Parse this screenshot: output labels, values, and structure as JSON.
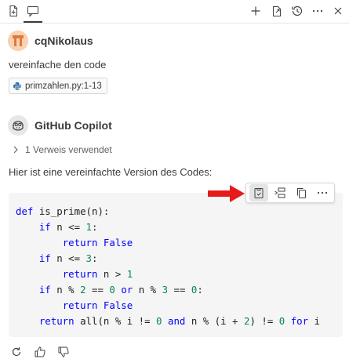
{
  "header": {
    "tabs": [
      {
        "icon": "new-file-icon"
      },
      {
        "icon": "chat-icon",
        "active": true
      }
    ],
    "actions": [
      {
        "icon": "plus-icon"
      },
      {
        "icon": "open-in-editor-icon"
      },
      {
        "icon": "history-icon"
      },
      {
        "icon": "more-icon"
      }
    ]
  },
  "user_message": {
    "username": "cqNikolaus",
    "text": "vereinfache den code",
    "reference_chip": "primzahlen.py:1-13"
  },
  "copilot": {
    "name": "GitHub Copilot",
    "references": "1 Verweis verwendet",
    "intro": "Hier ist eine vereinfachte Version des Codes:",
    "code_lines": [
      [
        {
          "t": "kw",
          "v": "def"
        },
        {
          "t": "plain",
          "v": " is_prime(n):"
        }
      ],
      [
        {
          "t": "plain",
          "v": "    "
        },
        {
          "t": "kw",
          "v": "if"
        },
        {
          "t": "plain",
          "v": " n <= "
        },
        {
          "t": "num",
          "v": "1"
        },
        {
          "t": "plain",
          "v": ":"
        }
      ],
      [
        {
          "t": "plain",
          "v": "        "
        },
        {
          "t": "kw",
          "v": "return"
        },
        {
          "t": "plain",
          "v": " "
        },
        {
          "t": "kw",
          "v": "False"
        }
      ],
      [
        {
          "t": "plain",
          "v": "    "
        },
        {
          "t": "kw",
          "v": "if"
        },
        {
          "t": "plain",
          "v": " n <= "
        },
        {
          "t": "num",
          "v": "3"
        },
        {
          "t": "plain",
          "v": ":"
        }
      ],
      [
        {
          "t": "plain",
          "v": "        "
        },
        {
          "t": "kw",
          "v": "return"
        },
        {
          "t": "plain",
          "v": " n > "
        },
        {
          "t": "num",
          "v": "1"
        }
      ],
      [
        {
          "t": "plain",
          "v": "    "
        },
        {
          "t": "kw",
          "v": "if"
        },
        {
          "t": "plain",
          "v": " n % "
        },
        {
          "t": "num",
          "v": "2"
        },
        {
          "t": "plain",
          "v": " == "
        },
        {
          "t": "num",
          "v": "0"
        },
        {
          "t": "plain",
          "v": " "
        },
        {
          "t": "kw",
          "v": "or"
        },
        {
          "t": "plain",
          "v": " n % "
        },
        {
          "t": "num",
          "v": "3"
        },
        {
          "t": "plain",
          "v": " == "
        },
        {
          "t": "num",
          "v": "0"
        },
        {
          "t": "plain",
          "v": ":"
        }
      ],
      [
        {
          "t": "plain",
          "v": "        "
        },
        {
          "t": "kw",
          "v": "return"
        },
        {
          "t": "plain",
          "v": " "
        },
        {
          "t": "kw",
          "v": "False"
        }
      ],
      [
        {
          "t": "plain",
          "v": "    "
        },
        {
          "t": "kw",
          "v": "return"
        },
        {
          "t": "plain",
          "v": " all(n % i != "
        },
        {
          "t": "num",
          "v": "0"
        },
        {
          "t": "plain",
          "v": " "
        },
        {
          "t": "kw",
          "v": "and"
        },
        {
          "t": "plain",
          "v": " n % (i + "
        },
        {
          "t": "num",
          "v": "2"
        },
        {
          "t": "plain",
          "v": ") != "
        },
        {
          "t": "num",
          "v": "0"
        },
        {
          "t": "plain",
          "v": " "
        },
        {
          "t": "kw",
          "v": "for"
        },
        {
          "t": "plain",
          "v": " i"
        }
      ]
    ],
    "code_toolbar": [
      {
        "icon": "apply-in-editor-icon",
        "hover": true
      },
      {
        "icon": "insert-at-cursor-icon"
      },
      {
        "icon": "copy-icon"
      },
      {
        "icon": "more-icon"
      }
    ]
  },
  "footer_actions": [
    {
      "icon": "retry-icon"
    },
    {
      "icon": "thumbs-up-icon"
    },
    {
      "icon": "thumbs-down-icon"
    }
  ],
  "colors": {
    "keyword": "#0000ff",
    "number": "#098658",
    "arrow": "#e51b1b",
    "code_bg": "#f5f5f5"
  }
}
